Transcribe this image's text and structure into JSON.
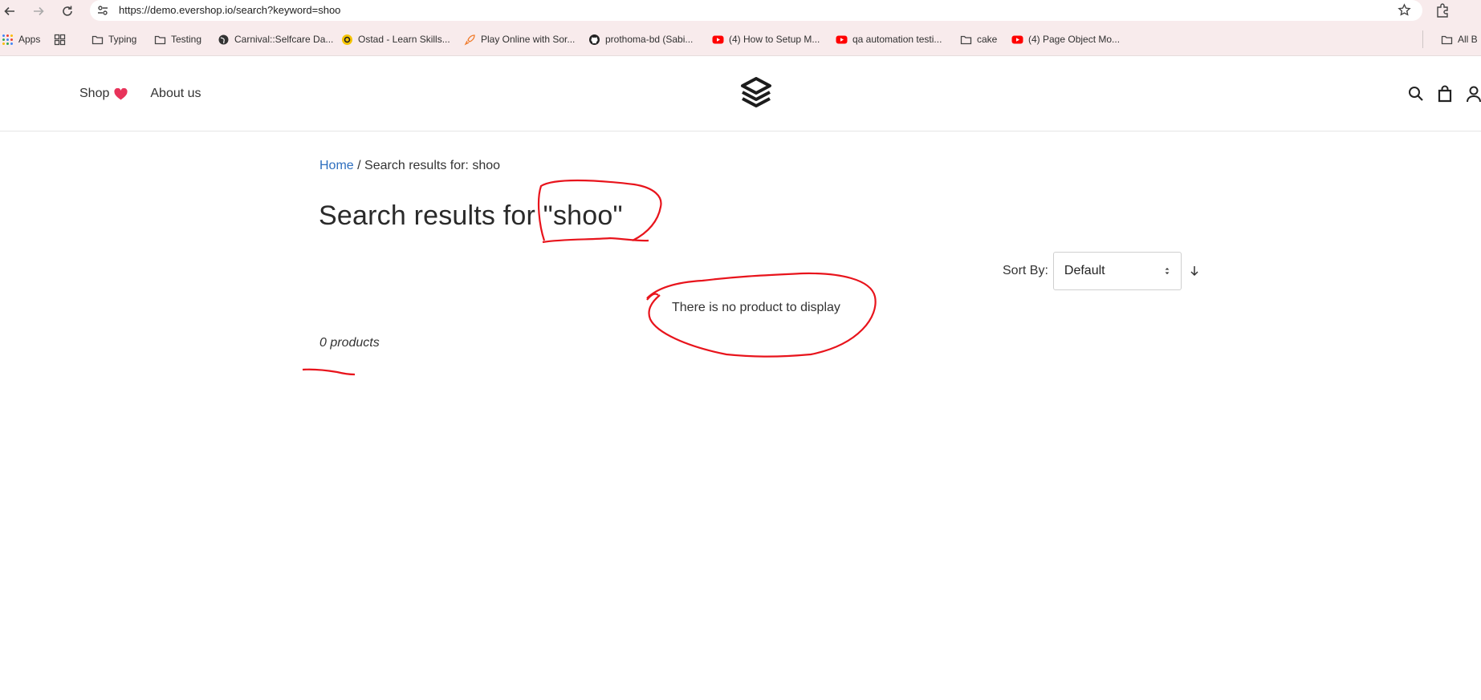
{
  "browser": {
    "url": "https://demo.evershop.io/search?keyword=shoo",
    "bookmarks": [
      {
        "label": "Apps",
        "icon": "apps-grid-icon"
      },
      {
        "label": "",
        "icon": "tab-groups-icon"
      },
      {
        "label": "Typing",
        "icon": "folder-icon"
      },
      {
        "label": "Testing",
        "icon": "folder-icon"
      },
      {
        "label": "Carnival::Selfcare Da...",
        "icon": "globe-icon"
      },
      {
        "label": "Ostad - Learn Skills...",
        "icon": "ostad-icon"
      },
      {
        "label": "Play Online with Sor...",
        "icon": "rocket-icon"
      },
      {
        "label": "prothoma-bd (Sabi...",
        "icon": "github-icon"
      },
      {
        "label": "(4) How to Setup M...",
        "icon": "youtube-icon"
      },
      {
        "label": "qa automation testi...",
        "icon": "youtube-icon"
      },
      {
        "label": "cake",
        "icon": "folder-icon"
      },
      {
        "label": "(4) Page Object Mo...",
        "icon": "youtube-icon"
      },
      {
        "label": "All B",
        "icon": "folder-icon"
      }
    ]
  },
  "header": {
    "menu": [
      {
        "label": "Shop"
      },
      {
        "label": "About us"
      }
    ]
  },
  "main": {
    "breadcrumb": {
      "home": "Home",
      "separator": "/",
      "current": "Search results for: shoo"
    },
    "title": "Search results for \"shoo\"",
    "sort": {
      "label": "Sort By:",
      "selected": "Default"
    },
    "empty_message": "There is no product to display",
    "product_count": "0 products"
  },
  "colors": {
    "chrome_bg": "#f8ebec",
    "link": "#2f6fbf",
    "annotation": "#e8141c",
    "heart": "#e8335a"
  }
}
